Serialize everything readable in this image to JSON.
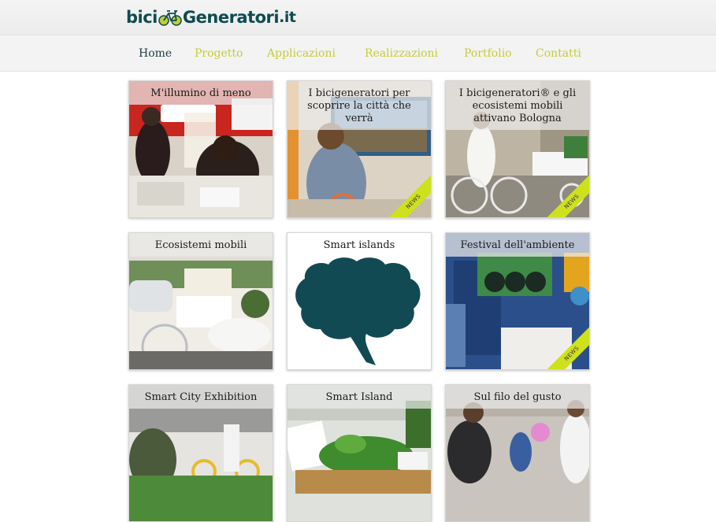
{
  "header": {
    "logo": {
      "part1": "bici",
      "part2": "Generatori",
      "part3": ".it"
    },
    "nav": [
      {
        "label": "Home"
      },
      {
        "label": "Progetto"
      },
      {
        "label": "Applicazioni"
      },
      {
        "label": "Realizzazioni"
      },
      {
        "label": "Portfolio"
      },
      {
        "label": "Contatti"
      }
    ]
  },
  "tiles": [
    {
      "title": "M'illumino di meno",
      "badge": ""
    },
    {
      "title": "I bicigeneratori per scoprire la città che verrà",
      "badge": "NEWS"
    },
    {
      "title": "I bicigeneratori® e gli ecosistemi mobili attivano Bologna",
      "badge": "NEWS"
    },
    {
      "title": "Ecosistemi mobili",
      "badge": ""
    },
    {
      "title": "Smart islands",
      "badge": ""
    },
    {
      "title": "Festival dell'ambiente",
      "badge": "NEWS"
    },
    {
      "title": "Smart City Exhibition",
      "badge": ""
    },
    {
      "title": "Smart Island",
      "badge": ""
    },
    {
      "title": "Sul filo del gusto",
      "badge": ""
    }
  ],
  "colors": {
    "accent": "#c5cc35",
    "brand": "#0f4b50",
    "badge": "#cfe11c"
  }
}
